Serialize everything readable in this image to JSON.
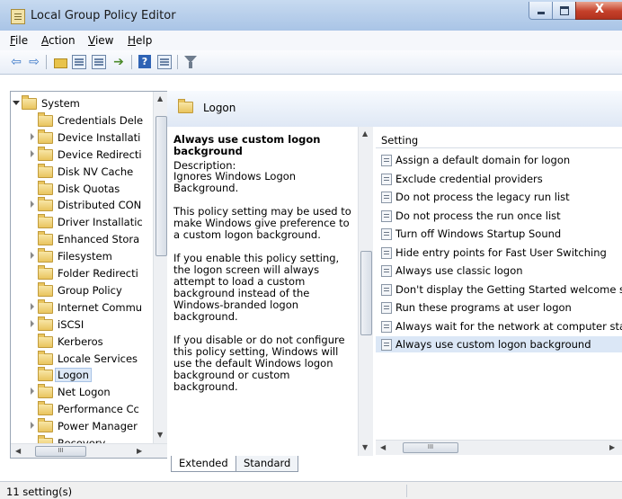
{
  "window": {
    "title": "Local Group Policy Editor",
    "close_glyph": "X"
  },
  "menu": [
    "File",
    "Action",
    "View",
    "Help"
  ],
  "toolbar": {
    "back": "⇦",
    "forward": "⇨",
    "export_arrow": "➔"
  },
  "tree": {
    "items": [
      {
        "label": "System",
        "state": "open",
        "indent": 0
      },
      {
        "label": "Credentials Dele",
        "state": "none",
        "indent": 1
      },
      {
        "label": "Device Installati",
        "state": "closed",
        "indent": 1
      },
      {
        "label": "Device Redirecti",
        "state": "closed",
        "indent": 1
      },
      {
        "label": "Disk NV Cache",
        "state": "none",
        "indent": 1
      },
      {
        "label": "Disk Quotas",
        "state": "none",
        "indent": 1
      },
      {
        "label": "Distributed CON",
        "state": "closed",
        "indent": 1
      },
      {
        "label": "Driver Installatic",
        "state": "none",
        "indent": 1
      },
      {
        "label": "Enhanced Stora",
        "state": "none",
        "indent": 1
      },
      {
        "label": "Filesystem",
        "state": "closed",
        "indent": 1
      },
      {
        "label": "Folder Redirecti",
        "state": "none",
        "indent": 1
      },
      {
        "label": "Group Policy",
        "state": "none",
        "indent": 1
      },
      {
        "label": "Internet Commu",
        "state": "closed",
        "indent": 1
      },
      {
        "label": "iSCSI",
        "state": "closed",
        "indent": 1
      },
      {
        "label": "Kerberos",
        "state": "none",
        "indent": 1
      },
      {
        "label": "Locale Services",
        "state": "none",
        "indent": 1
      },
      {
        "label": "Logon",
        "state": "none",
        "indent": 1,
        "selected": true
      },
      {
        "label": "Net Logon",
        "state": "closed",
        "indent": 1
      },
      {
        "label": "Performance Cc",
        "state": "none",
        "indent": 1
      },
      {
        "label": "Power Manager",
        "state": "closed",
        "indent": 1
      },
      {
        "label": "Recovery",
        "state": "none",
        "indent": 1
      }
    ],
    "hscroll_thumb": "III"
  },
  "header": {
    "title": "Logon"
  },
  "description": {
    "title": "Always use custom logon background",
    "label": "Description:",
    "text": "Ignores Windows Logon Background.\n\nThis policy setting may be used to make Windows give preference to a custom logon background.\n\nIf you enable this policy setting, the logon screen will always attempt to load a custom background instead of the Windows-branded logon background.\n\nIf you disable or do not configure this policy setting, Windows will use the default Windows logon background or custom background."
  },
  "settings": {
    "column_header": "Setting",
    "rows": [
      "Assign a default domain for logon",
      "Exclude credential providers",
      "Do not process the legacy run list",
      "Do not process the run once list",
      "Turn off Windows Startup Sound",
      "Hide entry points for Fast User Switching",
      "Always use classic logon",
      "Don't display the Getting Started welcome sc",
      "Run these programs at user logon",
      "Always wait for the network at computer star",
      "Always use custom logon background"
    ],
    "selected_index": 10,
    "hscroll_thumb": "III"
  },
  "tabs": [
    "Extended",
    "Standard"
  ],
  "status": {
    "text": "11 setting(s)"
  }
}
